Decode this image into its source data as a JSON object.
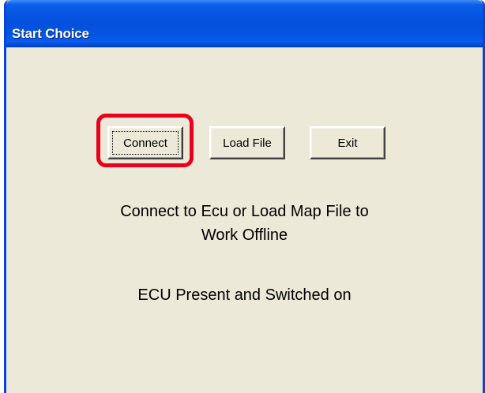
{
  "window": {
    "title": "Start Choice"
  },
  "buttons": {
    "connect_label": "Connect",
    "load_file_label": "Load File",
    "exit_label": "Exit"
  },
  "message": {
    "line1": "Connect to Ecu or Load Map File to",
    "line2": "Work Offline"
  },
  "status": {
    "text": "ECU Present and Switched on"
  },
  "colors": {
    "titlebar": "#0450dd",
    "dialog_background": "#ece9d8",
    "highlight": "#e8001c"
  }
}
